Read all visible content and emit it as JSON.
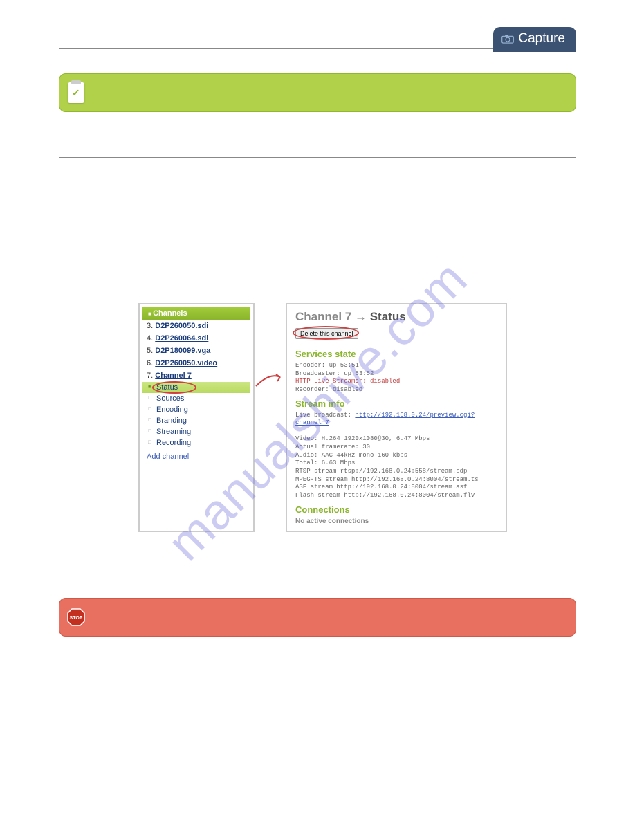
{
  "header": {
    "capture_label": "Capture"
  },
  "watermark": "manualshive.com",
  "sidebar": {
    "title": "Channels",
    "items": [
      {
        "num": "3.",
        "label": "D2P260050.sdi"
      },
      {
        "num": "4.",
        "label": "D2P260064.sdi"
      },
      {
        "num": "5.",
        "label": "D2P180099.vga"
      },
      {
        "num": "6.",
        "label": "D2P260050.video"
      },
      {
        "num": "7.",
        "label": "Channel 7"
      }
    ],
    "subs": [
      {
        "label": "Status",
        "active": true
      },
      {
        "label": "Sources"
      },
      {
        "label": "Encoding"
      },
      {
        "label": "Branding"
      },
      {
        "label": "Streaming"
      },
      {
        "label": "Recording"
      }
    ],
    "add": "Add channel"
  },
  "panel": {
    "title_prefix": "Channel 7",
    "title_arrow": "→",
    "title_suffix": "Status",
    "delete_btn": "Delete this channel",
    "services_h": "Services state",
    "services": {
      "l1": "Encoder: up 53:51",
      "l2": "Broadcaster: up 53:52",
      "l3": "HTTP Live Streamer: disabled",
      "l4": "Recorder: disabled"
    },
    "stream_h": "Stream info",
    "live_label": "Live broadcast: ",
    "live_url": "http://192.168.0.24/preview.cgi?channel=7",
    "info": {
      "l1": "Video: H.264 1920x1080@30, 6.47 Mbps",
      "l2": "Actual framerate: 30",
      "l3": "Audio: AAC 44kHz mono 160 kbps",
      "l4": "Total: 6.63 Mbps",
      "l5": "RTSP stream rtsp://192.168.0.24:558/stream.sdp",
      "l6": "MPEG-TS stream http://192.168.0.24:8004/stream.ts",
      "l7": "ASF stream http://192.168.0.24:8004/stream.asf",
      "l8": "Flash stream http://192.168.0.24:8004/stream.flv"
    },
    "conn_h": "Connections",
    "no_conn": "No active connections"
  }
}
